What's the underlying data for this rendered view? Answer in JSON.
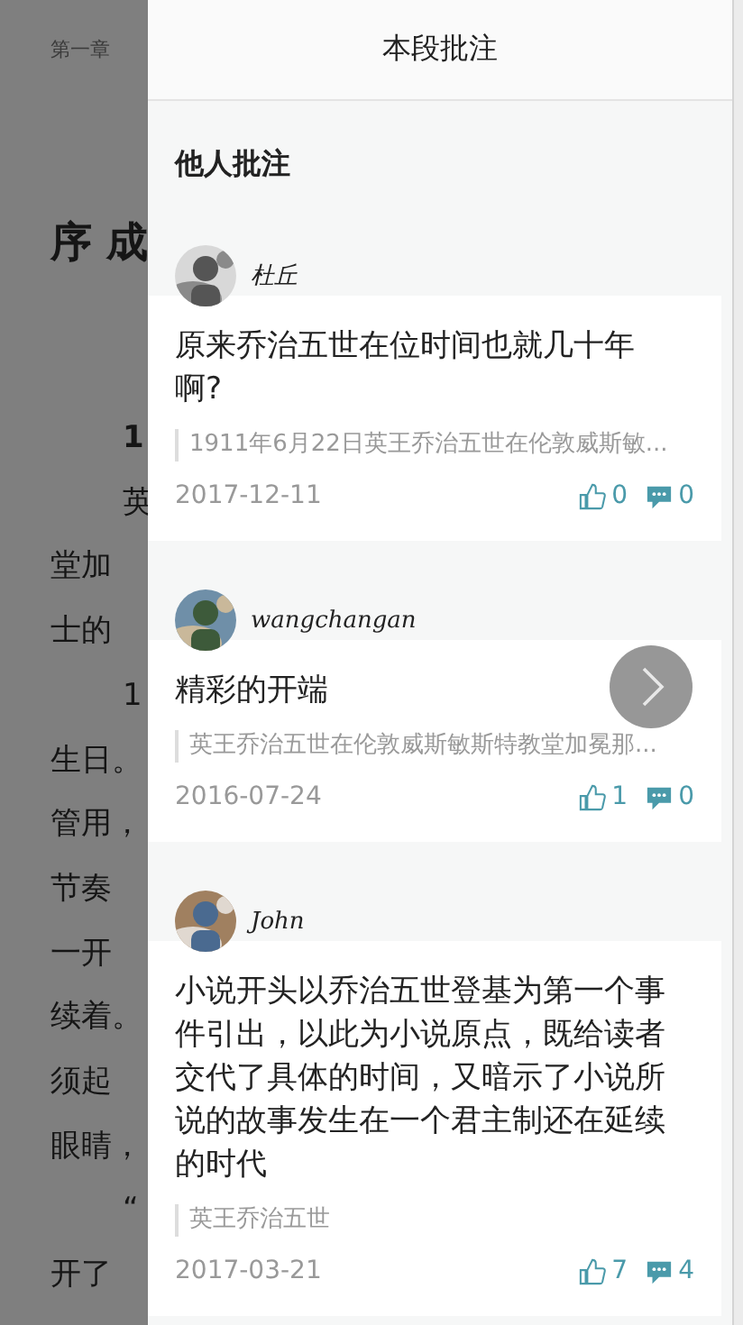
{
  "background_page": {
    "chapter": "第一章",
    "title": "序 成",
    "lines": [
      {
        "text": "1",
        "kind": "bold_indent"
      },
      {
        "text": "英",
        "kind": "indent"
      },
      {
        "text": "堂加",
        "kind": "plain"
      },
      {
        "text": "士的",
        "kind": "plain"
      },
      {
        "text": "1",
        "kind": "indent"
      },
      {
        "text": "生日。",
        "kind": "plain"
      },
      {
        "text": "管用，",
        "kind": "plain"
      },
      {
        "text": "节奏",
        "kind": "plain"
      },
      {
        "text": "一开",
        "kind": "plain"
      },
      {
        "text": "续着。",
        "kind": "plain"
      },
      {
        "text": "须起",
        "kind": "plain"
      },
      {
        "text": "眼睛，",
        "kind": "plain"
      },
      {
        "text": "“",
        "kind": "indent"
      },
      {
        "text": "开了",
        "kind": "plain"
      }
    ]
  },
  "panel": {
    "title": "本段批注",
    "section_title": "他人批注",
    "comments": [
      {
        "user": "杜丘",
        "text": "原来乔治五世在位时间也就几十年啊?",
        "quote": "1911年6月22日英王乔治五世在伦敦威斯敏...",
        "date": "2017-12-11",
        "likes": "0",
        "replies": "0"
      },
      {
        "user": "wangchangan",
        "text": "精彩的开端",
        "quote": "英王乔治五世在伦敦威斯敏斯特教堂加冕那...",
        "date": "2016-07-24",
        "likes": "1",
        "replies": "0"
      },
      {
        "user": "John",
        "text": "小说开头以乔治五世登基为第一个事件引出，以此为小说原点，既给读者交代了具体的时间，又暗示了小说所说的故事发生在一个君主制还在延续的时代",
        "quote": "英王乔治五世",
        "date": "2017-03-21",
        "likes": "7",
        "replies": "4"
      }
    ]
  }
}
